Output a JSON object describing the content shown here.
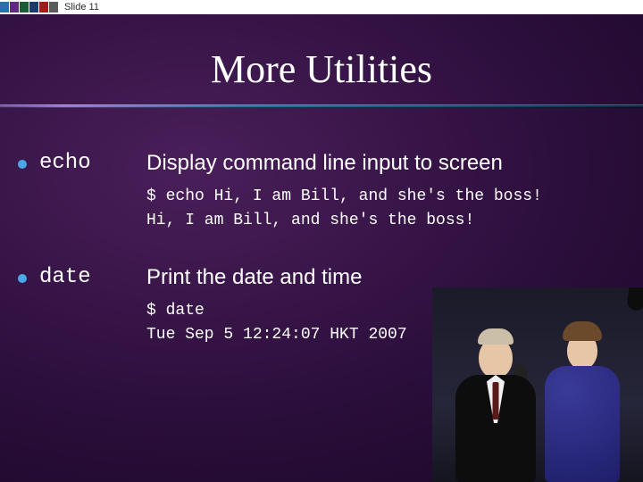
{
  "header": {
    "slide_label": "Slide 11",
    "logo_alt": "COMPANY"
  },
  "title": "More Utilities",
  "items": [
    {
      "command": "echo",
      "description": "Display command line input to screen",
      "terminal": "$ echo Hi, I am Bill, and she's the boss!\nHi, I am Bill, and she's the boss!"
    },
    {
      "command": "date",
      "description": "Print the date and time",
      "terminal": "$ date\nTue Sep 5 12:24:07 HKT 2007"
    }
  ],
  "image": {
    "alt": "Photograph of a man in a tuxedo waving and a woman in a blue gown"
  }
}
